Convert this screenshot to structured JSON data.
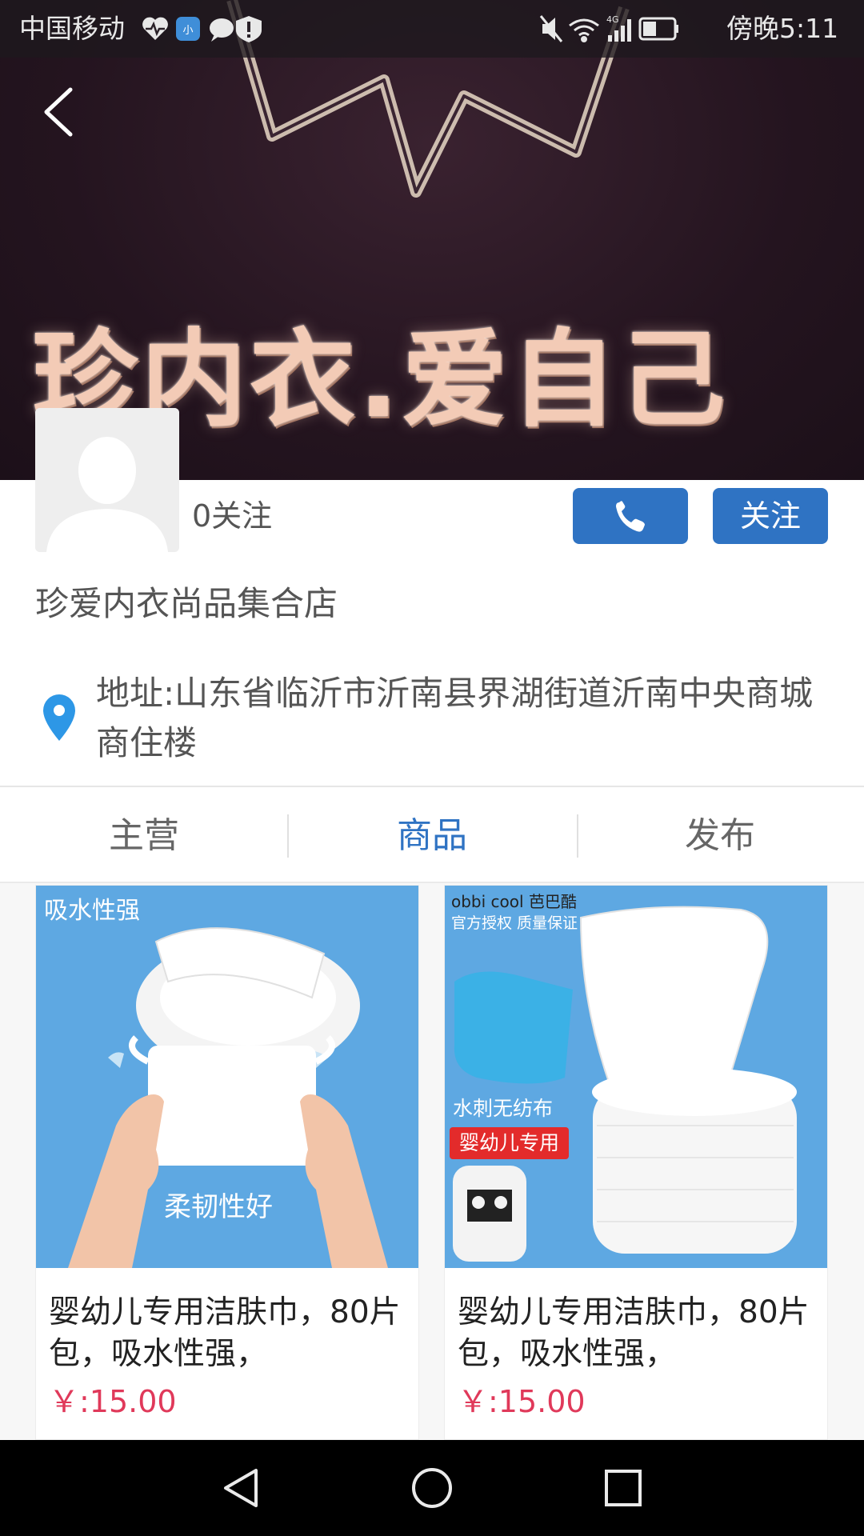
{
  "status_bar": {
    "carrier": "中国移动",
    "time": "傍晚5:11",
    "network": "4G",
    "left_icons": [
      "health-icon",
      "app-icon",
      "message-icon",
      "alert-icon"
    ],
    "right_icons": [
      "mute-icon",
      "wifi-icon",
      "signal-icon",
      "battery-icon"
    ]
  },
  "banner": {
    "slogan": "珍内衣.爱自己",
    "colors": {
      "background": "#24141f",
      "text": "#f3cbb6"
    }
  },
  "profile": {
    "follow_count": "0关注",
    "follow_button": "关注",
    "shop_name": "珍爱内衣尚品集合店",
    "address": "地址:山东省临沂市沂南县界湖街道沂南中央商城商住楼"
  },
  "tabs": [
    {
      "label": "主营",
      "active": false
    },
    {
      "label": "商品",
      "active": true
    },
    {
      "label": "发布",
      "active": false
    }
  ],
  "products": [
    {
      "title": "婴幼儿专用洁肤巾，80片包，吸水性强，",
      "price": "￥:15.00",
      "image_text": {
        "top": "吸水性强",
        "bottom": "柔韧性好"
      }
    },
    {
      "title": "婴幼儿专用洁肤巾，80片包，吸水性强，",
      "price": "￥:15.00",
      "image_text": {
        "brand": "obbi cool 芭巴酷",
        "tagline": "官方授权 质量保证",
        "feature": "水刺无纺布",
        "badge": "婴幼儿专用"
      }
    }
  ],
  "colors": {
    "accent": "#2f73c3",
    "price": "#e0395a",
    "nav_bar": "#000000"
  },
  "nav_bar": {
    "buttons": [
      "back-nav-icon",
      "home-nav-icon",
      "recents-nav-icon"
    ]
  }
}
